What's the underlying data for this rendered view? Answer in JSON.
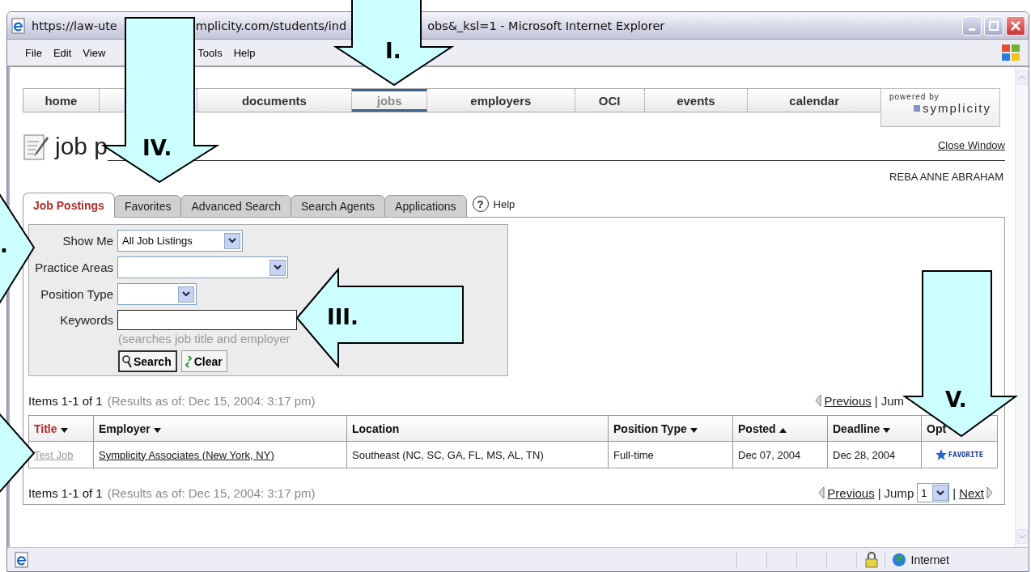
{
  "window": {
    "title_parts": [
      "https://law-ute",
      "mplicity.com/students/ind",
      "obs&_ksl=1 - Microsoft Internet Explorer"
    ]
  },
  "menu": [
    {
      "label": "File"
    },
    {
      "label": "Edit"
    },
    {
      "label": "View"
    },
    {
      "label": "Tools"
    },
    {
      "label": "Help"
    }
  ],
  "nav": [
    {
      "label": "home",
      "selected": false
    },
    {
      "label": "documents",
      "selected": false
    },
    {
      "label": "jobs",
      "selected": true
    },
    {
      "label": "employers",
      "selected": false
    },
    {
      "label": "OCI",
      "selected": false
    },
    {
      "label": "events",
      "selected": false
    },
    {
      "label": "calendar",
      "selected": false
    }
  ],
  "powered_by": {
    "caption": "powered by",
    "brand": "symplicity"
  },
  "heading": "job p",
  "close_link": "Close Window",
  "user": "REBA ANNE ABRAHAM",
  "tabs": [
    {
      "label": "Job Postings",
      "selected": true
    },
    {
      "label": "Favorites",
      "selected": false
    },
    {
      "label": "Advanced Search",
      "selected": false
    },
    {
      "label": "Search Agents",
      "selected": false
    },
    {
      "label": "Applications",
      "selected": false
    }
  ],
  "help_icon": "?",
  "help": "Help",
  "search": {
    "fields": [
      {
        "label": "Show Me",
        "kind": "select",
        "value": "All Job Listings"
      },
      {
        "label": "Practice Areas",
        "kind": "select"
      },
      {
        "label": "Position Type",
        "kind": "select"
      },
      {
        "label": "Keywords",
        "kind": "text"
      }
    ],
    "hint": "(searches job title and employer",
    "buttons": [
      "Search",
      "Clear"
    ]
  },
  "summaries": [
    {
      "count": "Items 1-1 of 1",
      "as_of": "(Results as of: Dec 15, 2004: 3:17 pm)"
    },
    {
      "count": "Items 1-1 of 1",
      "as_of": "(Results as of: Dec 15, 2004: 3:17 pm)"
    }
  ],
  "pagers": [
    [
      {
        "kind": "prev",
        "text": "Previous"
      },
      {
        "kind": "sep",
        "text": "|"
      },
      {
        "kind": "label",
        "text": "Jum"
      }
    ],
    [
      {
        "kind": "prev",
        "text": "Previous"
      },
      {
        "kind": "sep",
        "text": "|"
      },
      {
        "kind": "label",
        "text": "Jump"
      },
      {
        "kind": "select",
        "text": "1"
      },
      {
        "kind": "sep",
        "text": "|"
      },
      {
        "kind": "next",
        "text": "Next"
      }
    ]
  ],
  "table": {
    "columns": [
      {
        "label": "Title",
        "sortable": true,
        "ascending": false,
        "selected": true
      },
      {
        "label": "Employer",
        "sortable": true,
        "ascending": false,
        "selected": false
      },
      {
        "label": "Location",
        "sortable": false,
        "selected": false
      },
      {
        "label": "Position Type",
        "sortable": true,
        "ascending": false,
        "selected": false
      },
      {
        "label": "Posted",
        "sortable": true,
        "ascending": true,
        "selected": false
      },
      {
        "label": "Deadline",
        "sortable": true,
        "ascending": false,
        "selected": false
      },
      {
        "label": "Opt",
        "sortable": false,
        "selected": false
      }
    ],
    "rows": [
      {
        "title": "Test Job",
        "employer": "Symplicity Associates (New York, NY)",
        "location": "Southeast (NC, SC, GA, FL, MS, AL, TN)",
        "position_type": "Full-time",
        "posted": "Dec 07, 2004",
        "deadline": "Dec 28, 2004",
        "option": "FAVORITE"
      }
    ]
  },
  "status_bar": {
    "zone": "Internet"
  },
  "callouts": [
    {
      "kind": "arrow",
      "label": "I."
    },
    {
      "kind": "arrow",
      "label": "IV."
    },
    {
      "kind": "arrow",
      "label": "III."
    },
    {
      "kind": "arrow",
      "label": "V."
    },
    {
      "kind": "arrow",
      "label": "."
    },
    {
      "kind": "arrow"
    }
  ]
}
